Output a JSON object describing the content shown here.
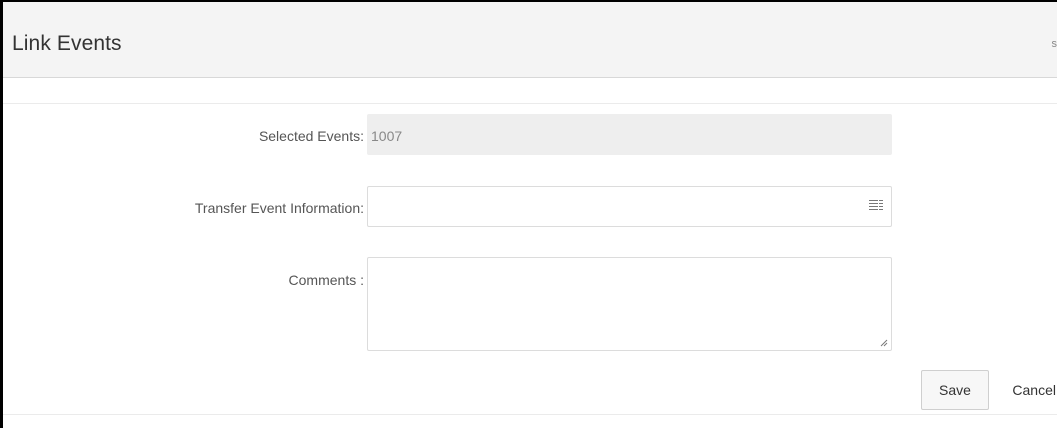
{
  "dialog": {
    "title": "Link Events",
    "header_edge_glyph": "s"
  },
  "form": {
    "selected_events": {
      "label": "Selected Events:",
      "value": "1007"
    },
    "transfer_event_information": {
      "label": "Transfer Event Information:",
      "value": "",
      "icon": "list-icon"
    },
    "comments": {
      "label": "Comments :",
      "value": ""
    }
  },
  "actions": {
    "save_label": "Save",
    "cancel_label": "Cancel"
  }
}
